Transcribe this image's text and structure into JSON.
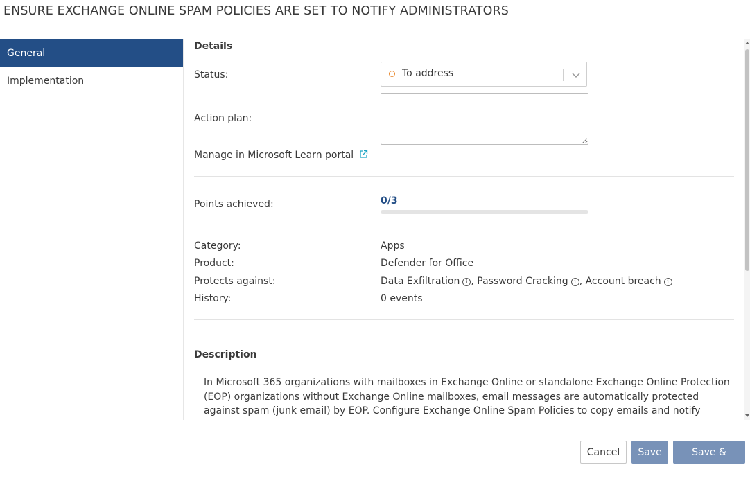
{
  "page": {
    "title": "ENSURE EXCHANGE ONLINE SPAM POLICIES ARE SET TO NOTIFY ADMINISTRATORS"
  },
  "sidebar": {
    "items": [
      {
        "label": "General",
        "active": true
      },
      {
        "label": "Implementation",
        "active": false
      }
    ]
  },
  "details": {
    "heading": "Details",
    "status_label": "Status:",
    "status_value": "To address",
    "status_color": "#e8862a",
    "action_plan_label": "Action plan:",
    "action_plan_value": "",
    "manage_link": "Manage in Microsoft Learn portal",
    "manage_link_icon": "external-link-icon"
  },
  "points": {
    "label": "Points achieved:",
    "value": "0/3",
    "achieved": 0,
    "max": 3
  },
  "info": {
    "category_label": "Category:",
    "category_value": "Apps",
    "product_label": "Product:",
    "product_value": "Defender for Office",
    "protects_label": "Protects against:",
    "protects": [
      "Data Exfiltration",
      "Password Cracking",
      "Account breach"
    ],
    "history_label": "History:",
    "history_value": "0 events"
  },
  "description": {
    "heading": "Description",
    "text": "In Microsoft 365 organizations with mailboxes in Exchange Online or standalone Exchange Online Protection (EOP) organizations without Exchange Online mailboxes, email messages are automatically protected against spam (junk email) by EOP. Configure Exchange Online Spam Policies to copy emails and notify someone when a sender in the"
  },
  "footer": {
    "cancel_label": "Cancel",
    "save_label": "Save",
    "save_close_label": "Save & close"
  },
  "colors": {
    "accent": "#234e86",
    "button_primary": "#7892b8"
  }
}
